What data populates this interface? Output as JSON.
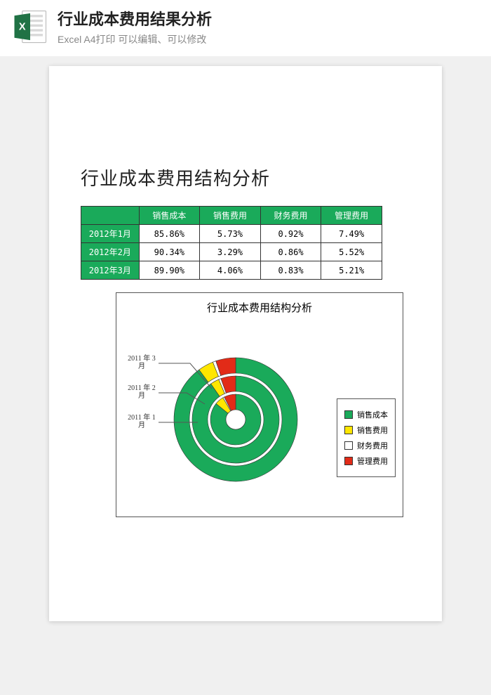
{
  "header": {
    "title": "行业成本费用结果分析",
    "subtitle": "Excel A4打印 可以编辑、可以修改"
  },
  "doc": {
    "title": "行业成本费用结构分析"
  },
  "table": {
    "columns": [
      "销售成本",
      "销售费用",
      "财务费用",
      "管理费用"
    ],
    "rows": [
      {
        "label": "2012年1月",
        "values": [
          "85.86%",
          "5.73%",
          "0.92%",
          "7.49%"
        ]
      },
      {
        "label": "2012年2月",
        "values": [
          "90.34%",
          "3.29%",
          "0.86%",
          "5.52%"
        ]
      },
      {
        "label": "2012年3月",
        "values": [
          "89.90%",
          "4.06%",
          "0.83%",
          "5.21%"
        ]
      }
    ]
  },
  "chart_data": {
    "type": "pie",
    "title": "行业成本费用结构分析",
    "ring_labels": [
      "2011 年 1月",
      "2011 年 2月",
      "2011 年 3月"
    ],
    "legend": [
      {
        "name": "销售成本",
        "color": "#1aaa5a"
      },
      {
        "name": "销售费用",
        "color": "#ffe600"
      },
      {
        "name": "财务费用",
        "color": "#ffffff"
      },
      {
        "name": "管理费用",
        "color": "#e22b18"
      }
    ],
    "series": [
      {
        "name": "2011 年 1月",
        "values": [
          85.86,
          5.73,
          0.92,
          7.49
        ]
      },
      {
        "name": "2011 年 2月",
        "values": [
          90.34,
          3.29,
          0.86,
          5.52
        ]
      },
      {
        "name": "2011 年 3月",
        "values": [
          89.9,
          4.06,
          0.83,
          5.21
        ]
      }
    ]
  }
}
